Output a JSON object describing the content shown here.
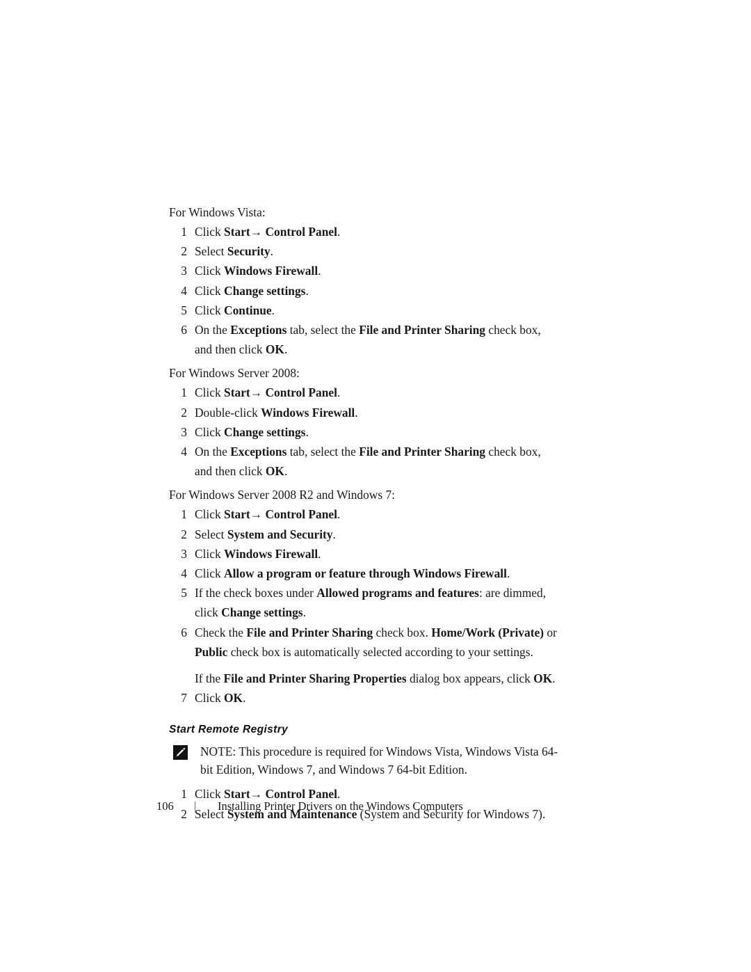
{
  "document": {
    "sections": [
      {
        "intro": "For Windows Vista:",
        "steps": [
          {
            "num": "1",
            "parts": [
              {
                "t": "Click ",
                "b": false
              },
              {
                "t": "Start→ Control Panel",
                "b": true
              },
              {
                "t": ".",
                "b": false
              }
            ]
          },
          {
            "num": "2",
            "parts": [
              {
                "t": "Select ",
                "b": false
              },
              {
                "t": "Security",
                "b": true
              },
              {
                "t": ".",
                "b": false
              }
            ]
          },
          {
            "num": "3",
            "parts": [
              {
                "t": "Click ",
                "b": false
              },
              {
                "t": "Windows Firewall",
                "b": true
              },
              {
                "t": ".",
                "b": false
              }
            ]
          },
          {
            "num": "4",
            "parts": [
              {
                "t": "Click ",
                "b": false
              },
              {
                "t": "Change settings",
                "b": true
              },
              {
                "t": ".",
                "b": false
              }
            ]
          },
          {
            "num": "5",
            "parts": [
              {
                "t": "Click ",
                "b": false
              },
              {
                "t": "Continue",
                "b": true
              },
              {
                "t": ".",
                "b": false
              }
            ]
          },
          {
            "num": "6",
            "parts": [
              {
                "t": "On the ",
                "b": false
              },
              {
                "t": "Exceptions",
                "b": true
              },
              {
                "t": " tab, select the ",
                "b": false
              },
              {
                "t": "File and Printer Sharing",
                "b": true
              },
              {
                "t": " check box, and then click ",
                "b": false
              },
              {
                "t": "OK",
                "b": true
              },
              {
                "t": ".",
                "b": false
              }
            ]
          }
        ]
      },
      {
        "intro": "For Windows Server 2008:",
        "steps": [
          {
            "num": "1",
            "parts": [
              {
                "t": "Click ",
                "b": false
              },
              {
                "t": "Start→ Control Panel",
                "b": true
              },
              {
                "t": ".",
                "b": false
              }
            ]
          },
          {
            "num": "2",
            "parts": [
              {
                "t": "Double-click ",
                "b": false
              },
              {
                "t": "Windows Firewall",
                "b": true
              },
              {
                "t": ".",
                "b": false
              }
            ]
          },
          {
            "num": "3",
            "parts": [
              {
                "t": "Click ",
                "b": false
              },
              {
                "t": "Change settings",
                "b": true
              },
              {
                "t": ".",
                "b": false
              }
            ]
          },
          {
            "num": "4",
            "parts": [
              {
                "t": "On the ",
                "b": false
              },
              {
                "t": "Exceptions",
                "b": true
              },
              {
                "t": " tab, select the ",
                "b": false
              },
              {
                "t": "File and Printer Sharing",
                "b": true
              },
              {
                "t": " check box, and then click ",
                "b": false
              },
              {
                "t": "OK",
                "b": true
              },
              {
                "t": ".",
                "b": false
              }
            ]
          }
        ]
      },
      {
        "intro": "For Windows Server 2008 R2 and Windows 7:",
        "steps": [
          {
            "num": "1",
            "parts": [
              {
                "t": "Click ",
                "b": false
              },
              {
                "t": "Start→ Control Panel",
                "b": true
              },
              {
                "t": ".",
                "b": false
              }
            ]
          },
          {
            "num": "2",
            "parts": [
              {
                "t": "Select ",
                "b": false
              },
              {
                "t": "System and Security",
                "b": true
              },
              {
                "t": ".",
                "b": false
              }
            ]
          },
          {
            "num": "3",
            "parts": [
              {
                "t": "Click ",
                "b": false
              },
              {
                "t": "Windows Firewall",
                "b": true
              },
              {
                "t": ".",
                "b": false
              }
            ]
          },
          {
            "num": "4",
            "parts": [
              {
                "t": "Click ",
                "b": false
              },
              {
                "t": "Allow a program or feature through Windows Firewall",
                "b": true
              },
              {
                "t": ".",
                "b": false
              }
            ]
          },
          {
            "num": "5",
            "parts": [
              {
                "t": "If the check boxes under ",
                "b": false
              },
              {
                "t": "Allowed programs and features",
                "b": true
              },
              {
                "t": ": are dimmed, click ",
                "b": false
              },
              {
                "t": "Change settings",
                "b": true
              },
              {
                "t": ".",
                "b": false
              }
            ]
          },
          {
            "num": "6",
            "parts": [
              {
                "t": "Check the ",
                "b": false
              },
              {
                "t": "File and Printer Sharing",
                "b": true
              },
              {
                "t": " check box. ",
                "b": false
              },
              {
                "t": "Home/Work (Private)",
                "b": true
              },
              {
                "t": " or ",
                "b": false
              },
              {
                "t": "Public",
                "b": true
              },
              {
                "t": " check box is automatically selected according to your settings.",
                "b": false
              }
            ],
            "extra": [
              {
                "t": "If the ",
                "b": false
              },
              {
                "t": "File and Printer Sharing Properties",
                "b": true
              },
              {
                "t": " dialog box appears, click ",
                "b": false
              },
              {
                "t": "OK",
                "b": true
              },
              {
                "t": ".",
                "b": false
              }
            ]
          },
          {
            "num": "7",
            "parts": [
              {
                "t": "Click ",
                "b": false
              },
              {
                "t": "OK",
                "b": true
              },
              {
                "t": ".",
                "b": false
              }
            ]
          }
        ]
      }
    ],
    "remote_registry": {
      "heading": "Start Remote Registry",
      "note": {
        "icon": "note-pencil-icon",
        "label": "NOTE:",
        "text": "This procedure is required for Windows Vista, Windows Vista 64-bit Edition, Windows 7, and Windows 7 64-bit Edition."
      },
      "steps": [
        {
          "num": "1",
          "parts": [
            {
              "t": "Click ",
              "b": false
            },
            {
              "t": "Start→ Control Panel",
              "b": true
            },
            {
              "t": ".",
              "b": false
            }
          ]
        },
        {
          "num": "2",
          "parts": [
            {
              "t": "Select ",
              "b": false
            },
            {
              "t": "System and Maintenance",
              "b": true
            },
            {
              "t": " (System and Security for Windows 7).",
              "b": false
            }
          ]
        }
      ]
    },
    "footer": {
      "page_number": "106",
      "separator": "|",
      "title": "Installing Printer Drivers on the Windows Computers"
    }
  }
}
